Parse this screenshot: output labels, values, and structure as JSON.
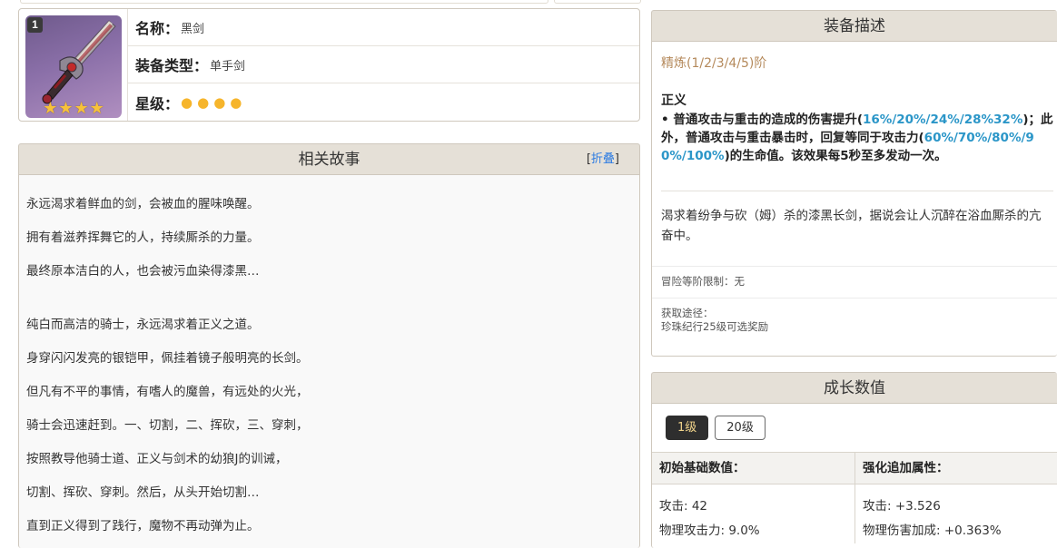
{
  "weapon": {
    "refine_level": "1",
    "stars": 4,
    "name_label": "名称：",
    "name": "黑剑",
    "type_label": "装备类型：",
    "type": "单手剑",
    "rarity_label": "星级："
  },
  "story": {
    "title": "相关故事",
    "fold_open": "[",
    "fold_label": "折叠",
    "fold_close": "]",
    "lines": [
      "永远渴求着鲜血的剑，会被血的腥味唤醒。",
      "拥有着滋养挥舞它的人，持续厮杀的力量。",
      "最终原本洁白的人，也会被污血染得漆黑…",
      "纯白而高洁的骑士，永远渴求着正义之道。",
      "身穿闪闪发亮的银铠甲，佩挂着镜子般明亮的长剑。",
      "但凡有不平的事情，有嗜人的魔兽，有远处的火光，",
      "骑士会迅速赶到。一、切割，二、挥砍，三、穿刺，",
      "按照教导他骑士道、正义与剑术的幼狼J的训诫，",
      "切割、挥砍、穿刺。然后，从头开始切割…",
      "直到正义得到了践行，魔物不再动弹为止。"
    ]
  },
  "description": {
    "title": "装备描述",
    "refine_text": "精炼(1/2/3/4/5)阶",
    "passive_name": "正义",
    "passive_p1": "• 普通攻击与重击的造成的伤害提升(",
    "passive_v1": "16%/20%/24%/28%32%",
    "passive_p2": ")；此外，普通攻击与重击暴击时，回复等同于攻击力(",
    "passive_v2": "60%/70%/80%/90%/100%",
    "passive_p3": ")的生命值。该效果每5秒至多发动一次。",
    "flavor": "渴求着纷争与砍（姆）杀的漆黑长剑，据说会让人沉醉在浴血厮杀的亢奋中。",
    "adventure_rank": "冒险等阶限制：无",
    "obtain_label": "获取途径：",
    "obtain_value": "珍珠纪行25级可选奖励"
  },
  "growth": {
    "title": "成长数值",
    "levels": [
      "1级",
      "20级"
    ],
    "active_level": "1级",
    "base_header": "初始基础数值：",
    "bonus_header": "强化追加属性：",
    "base_stats": [
      "攻击: 42",
      "物理攻击力: 9.0%"
    ],
    "bonus_stats": [
      "攻击: +3.526",
      "物理伤害加成: +0.363%"
    ]
  },
  "colors": {
    "panel_header": "#e5e0d7",
    "border": "#cfc8bd",
    "highlight": "#2b96c8",
    "refine_text": "#b58a5c",
    "link": "#2a7ae2",
    "star": "#f7c23a"
  },
  "icons": {
    "weapon": "black-sword-icon",
    "star": "star-icon"
  }
}
